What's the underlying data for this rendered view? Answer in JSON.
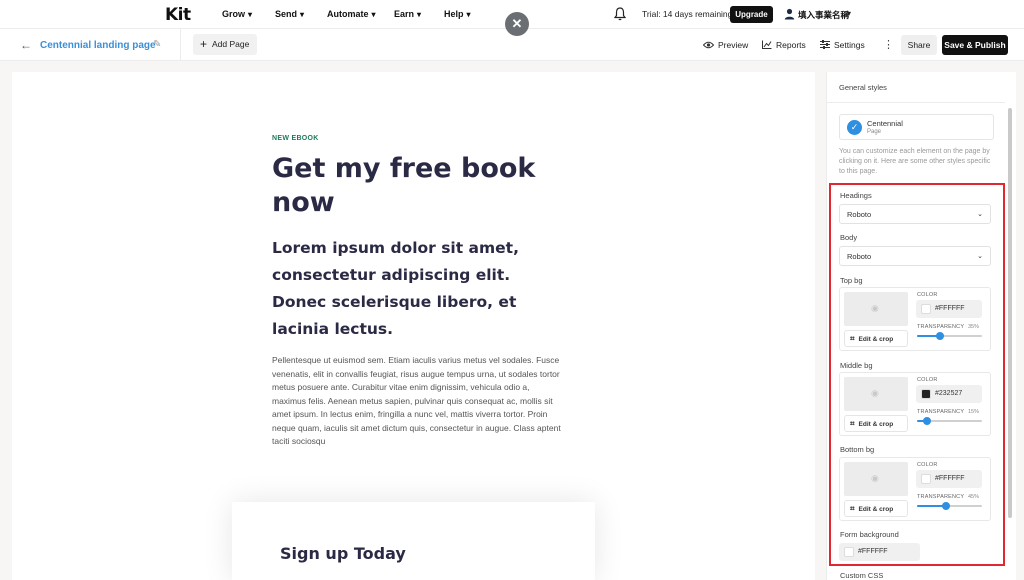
{
  "nav": {
    "logo": "Kit",
    "items": [
      {
        "label": "Grow",
        "chevron": "▾"
      },
      {
        "label": "Send",
        "chevron": "▾"
      },
      {
        "label": "Automate",
        "chevron": "▾"
      },
      {
        "label": "Earn",
        "chevron": "▾"
      },
      {
        "label": "Help",
        "chevron": "▾"
      }
    ],
    "close_glyph": "✕",
    "trial_text": "Trial: 14 days remaining",
    "upgrade_label": "Upgrade",
    "account_name": "填入事業名稱",
    "account_chevron": "▾"
  },
  "toolbar": {
    "back_glyph": "←",
    "page_name": "Centennial landing page",
    "edit_glyph": "✎",
    "add_page_plus": "+",
    "add_page_label": "Add Page",
    "preview_label": "Preview",
    "reports_label": "Reports",
    "settings_label": "Settings",
    "more_glyph": "⋮",
    "share_label": "Share",
    "publish_label": "Save & Publish"
  },
  "canvas": {
    "eyebrow": "NEW EBOOK",
    "headline": "Get my free book now",
    "subhead": "Lorem ipsum dolor sit amet, consectetur adipiscing elit. Donec scelerisque libero, et lacinia lectus.",
    "body": "Pellentesque ut euismod sem. Etiam iaculis varius metus vel sodales. Fusce venenatis, elit in convallis feugiat, risus augue tempus urna, ut sodales tortor metus posuere ante. Curabitur vitae enim dignissim, vehicula odio a, maximus felis. Aenean metus sapien, pulvinar quis consequat ac, mollis sit amet ipsum. In lectus enim, fringilla a nunc vel, mattis viverra tortor. Proin neque quam, iaculis sit amet dictum quis, consectetur in augue. Class aptent taciti sociosqu",
    "form_title": "Sign up Today"
  },
  "sidebar": {
    "title": "General styles",
    "template_check": "✓",
    "template_name": "Centennial",
    "template_type": "Page",
    "help_text": "You can customize each element on the page by clicking on it. Here are some other styles specific to this page.",
    "headings_label": "Headings",
    "headings_value": "Roboto",
    "body_label": "Body",
    "body_value": "Roboto",
    "select_chevron": "⌄",
    "color_caption": "COLOR",
    "transparency_caption": "TRANSPARENCY",
    "edit_crop_glyph": "⌗",
    "edit_crop_label": "Edit & crop",
    "eye_glyph": "◉",
    "top_bg": {
      "label": "Top bg",
      "hex": "#FFFFFF",
      "swatch": "#FFFFFF",
      "transparency": "35%",
      "level": 0.35
    },
    "middle_bg": {
      "label": "Middle bg",
      "hex": "#232527",
      "swatch": "#232527",
      "transparency": "15%",
      "level": 0.15
    },
    "bottom_bg": {
      "label": "Bottom bg",
      "hex": "#FFFFFF",
      "swatch": "#FFFFFF",
      "transparency": "45%",
      "level": 0.45
    },
    "form_bg": {
      "label": "Form background",
      "hex": "#FFFFFF",
      "swatch": "#FFFFFF"
    },
    "custom_css_label": "Custom CSS"
  },
  "colors": {
    "accent": "#2f8fe0",
    "highlight": "#e0282e",
    "heading_text": "#2b2a45",
    "eyebrow": "#1f7a5c"
  }
}
